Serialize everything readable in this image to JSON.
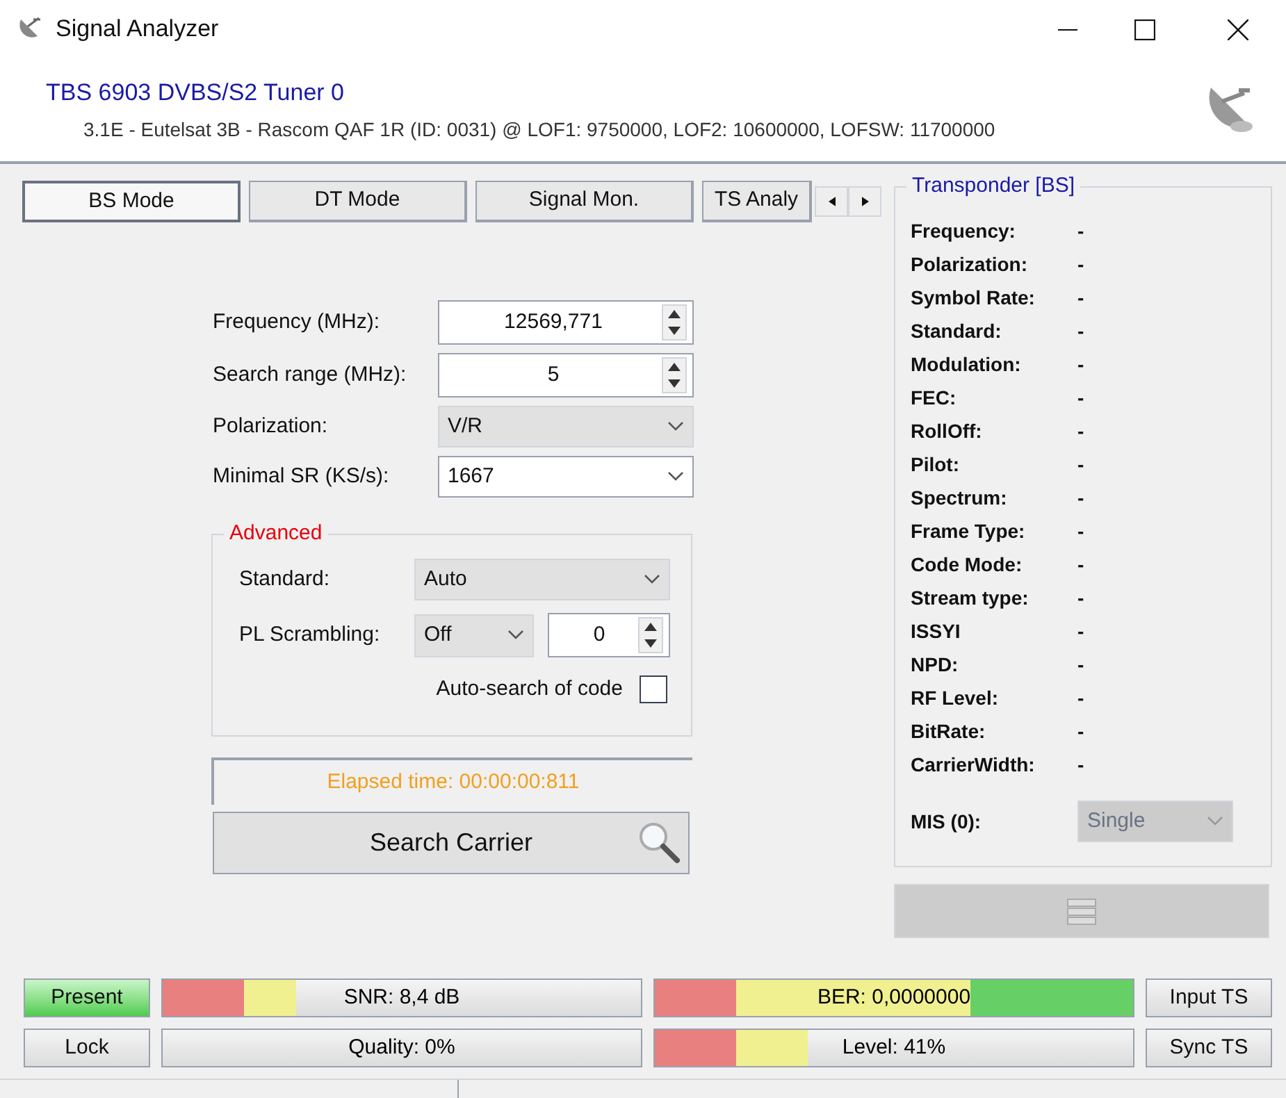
{
  "window": {
    "title": "Signal Analyzer"
  },
  "header": {
    "device": "TBS 6903 DVBS/S2 Tuner 0",
    "satellite": "3.1E - Eutelsat 3B - Rascom QAF 1R (ID: 0031) @ LOF1: 9750000, LOF2: 10600000, LOFSW: 11700000"
  },
  "tabs": [
    {
      "label": "BS Mode",
      "selected": true
    },
    {
      "label": "DT Mode",
      "selected": false
    },
    {
      "label": "Signal Mon.",
      "selected": false
    },
    {
      "label": "TS Analy",
      "selected": false
    }
  ],
  "form": [
    {
      "label": "Frequency (MHz):",
      "kind": "spin",
      "value": "12569,771"
    },
    {
      "label": "Search range (MHz):",
      "kind": "spin",
      "value": "5"
    },
    {
      "label": "Polarization:",
      "kind": "select",
      "value": "V/R"
    },
    {
      "label": "Minimal SR (KS/s):",
      "kind": "combo",
      "value": "1667"
    }
  ],
  "advanced": {
    "title": "Advanced",
    "standard_label": "Standard:",
    "standard": "Auto",
    "pl_label": "PL Scrambling:",
    "pl_mode": "Off",
    "pl_code": "0",
    "auto_search_label": "Auto-search of code",
    "auto_search_checked": false
  },
  "elapsed": "Elapsed time: 00:00:00:811",
  "search_button": "Search Carrier",
  "transponder": {
    "title": "Transponder [BS]",
    "rows": [
      {
        "label": "Frequency:",
        "value": "-"
      },
      {
        "label": "Polarization:",
        "value": "-"
      },
      {
        "label": "Symbol Rate:",
        "value": "-"
      },
      {
        "label": "Standard:",
        "value": "-"
      },
      {
        "label": "Modulation:",
        "value": "-"
      },
      {
        "label": "FEC:",
        "value": "-"
      },
      {
        "label": "RollOff:",
        "value": "-"
      },
      {
        "label": "Pilot:",
        "value": "-"
      },
      {
        "label": "Spectrum:",
        "value": "-"
      },
      {
        "label": "Frame Type:",
        "value": "-"
      },
      {
        "label": "Code Mode:",
        "value": "-"
      },
      {
        "label": "Stream type:",
        "value": "-"
      },
      {
        "label": "ISSYI",
        "value": "-"
      },
      {
        "label": "NPD:",
        "value": "-"
      },
      {
        "label": "RF Level:",
        "value": "-"
      },
      {
        "label": "BitRate:",
        "value": "-"
      },
      {
        "label": "CarrierWidth:",
        "value": "-"
      }
    ],
    "mis_label": "MIS (0):",
    "mis_value": "Single"
  },
  "indicators": [
    {
      "label": "Present",
      "on": true
    },
    {
      "label": "Lock",
      "on": false
    }
  ],
  "meters": [
    {
      "text": "SNR: 8,4 dB",
      "level": 0.28
    },
    {
      "text": "BER: 0,0000000",
      "level": 1.0
    },
    {
      "text": "Quality: 0%"
    },
    {
      "text": "Level: 41%",
      "level": 0.32
    }
  ],
  "ts_buttons": [
    "Input TS",
    "Sync TS"
  ]
}
